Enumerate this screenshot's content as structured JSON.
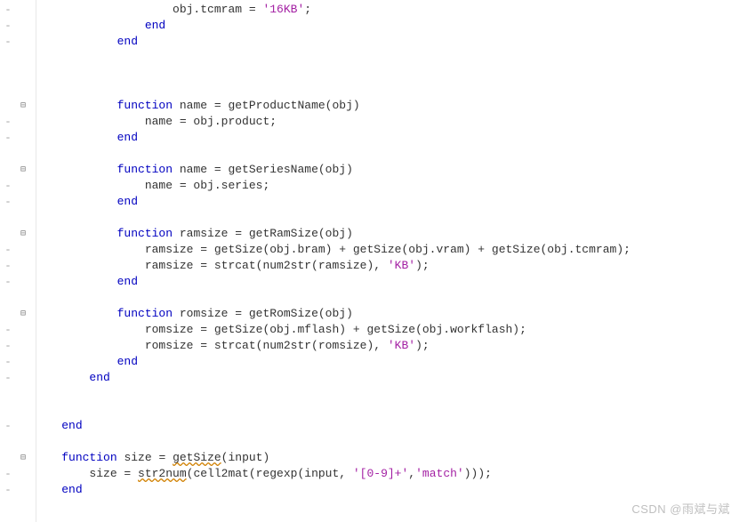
{
  "gutter": {
    "dash": "-",
    "blank": ""
  },
  "fold": {
    "minus": "⊟",
    "plus": "⊞",
    "blank": ""
  },
  "lines": [
    {
      "g": "dash",
      "f": "blank",
      "indent": 20,
      "tokens": [
        {
          "t": "id",
          "v": "obj.tcmram = "
        },
        {
          "t": "str",
          "v": "'16KB'"
        },
        {
          "t": "id",
          "v": ";"
        }
      ]
    },
    {
      "g": "dash",
      "f": "blank",
      "indent": 16,
      "tokens": [
        {
          "t": "kw",
          "v": "end"
        }
      ]
    },
    {
      "g": "dash",
      "f": "blank",
      "indent": 12,
      "tokens": [
        {
          "t": "kw",
          "v": "end"
        }
      ]
    },
    {
      "g": "blank",
      "f": "blank",
      "indent": 0,
      "tokens": []
    },
    {
      "g": "blank",
      "f": "blank",
      "indent": 0,
      "tokens": []
    },
    {
      "g": "blank",
      "f": "blank",
      "indent": 0,
      "tokens": []
    },
    {
      "g": "blank",
      "f": "minus",
      "indent": 12,
      "tokens": [
        {
          "t": "kw",
          "v": "function"
        },
        {
          "t": "id",
          "v": " name = getProductName(obj)"
        }
      ]
    },
    {
      "g": "dash",
      "f": "blank",
      "indent": 16,
      "tokens": [
        {
          "t": "id",
          "v": "name = obj.product;"
        }
      ]
    },
    {
      "g": "dash",
      "f": "blank",
      "indent": 12,
      "tokens": [
        {
          "t": "kw",
          "v": "end"
        }
      ]
    },
    {
      "g": "blank",
      "f": "blank",
      "indent": 0,
      "tokens": []
    },
    {
      "g": "blank",
      "f": "minus",
      "indent": 12,
      "tokens": [
        {
          "t": "kw",
          "v": "function"
        },
        {
          "t": "id",
          "v": " name = getSeriesName(obj)"
        }
      ]
    },
    {
      "g": "dash",
      "f": "blank",
      "indent": 16,
      "tokens": [
        {
          "t": "id",
          "v": "name = obj.series;"
        }
      ]
    },
    {
      "g": "dash",
      "f": "blank",
      "indent": 12,
      "tokens": [
        {
          "t": "kw",
          "v": "end"
        }
      ]
    },
    {
      "g": "blank",
      "f": "blank",
      "indent": 0,
      "tokens": []
    },
    {
      "g": "blank",
      "f": "minus",
      "indent": 12,
      "tokens": [
        {
          "t": "kw",
          "v": "function"
        },
        {
          "t": "id",
          "v": " ramsize = getRamSize(obj)"
        }
      ]
    },
    {
      "g": "dash",
      "f": "blank",
      "indent": 16,
      "tokens": [
        {
          "t": "id",
          "v": "ramsize = getSize(obj.bram) + getSize(obj.vram) + getSize(obj.tcmram);"
        }
      ]
    },
    {
      "g": "dash",
      "f": "blank",
      "indent": 16,
      "tokens": [
        {
          "t": "id",
          "v": "ramsize = strcat(num2str(ramsize), "
        },
        {
          "t": "str",
          "v": "'KB'"
        },
        {
          "t": "id",
          "v": ");"
        }
      ]
    },
    {
      "g": "dash",
      "f": "blank",
      "indent": 12,
      "tokens": [
        {
          "t": "kw",
          "v": "end"
        }
      ]
    },
    {
      "g": "blank",
      "f": "blank",
      "indent": 0,
      "tokens": []
    },
    {
      "g": "blank",
      "f": "minus",
      "indent": 12,
      "tokens": [
        {
          "t": "kw",
          "v": "function"
        },
        {
          "t": "id",
          "v": " romsize = getRomSize(obj)"
        }
      ]
    },
    {
      "g": "dash",
      "f": "blank",
      "indent": 16,
      "tokens": [
        {
          "t": "id",
          "v": "romsize = getSize(obj.mflash) + getSize(obj.workflash);"
        }
      ]
    },
    {
      "g": "dash",
      "f": "blank",
      "indent": 16,
      "tokens": [
        {
          "t": "id",
          "v": "romsize = strcat(num2str(romsize), "
        },
        {
          "t": "str",
          "v": "'KB'"
        },
        {
          "t": "id",
          "v": ");"
        }
      ]
    },
    {
      "g": "dash",
      "f": "blank",
      "indent": 12,
      "tokens": [
        {
          "t": "kw",
          "v": "end"
        }
      ]
    },
    {
      "g": "dash",
      "f": "blank",
      "indent": 8,
      "tokens": [
        {
          "t": "kw",
          "v": "end"
        }
      ]
    },
    {
      "g": "blank",
      "f": "blank",
      "indent": 0,
      "tokens": []
    },
    {
      "g": "blank",
      "f": "blank",
      "indent": 0,
      "tokens": []
    },
    {
      "g": "dash",
      "f": "blank",
      "indent": 4,
      "tokens": [
        {
          "t": "kw",
          "v": "end"
        }
      ]
    },
    {
      "g": "blank",
      "f": "blank",
      "indent": 0,
      "tokens": []
    },
    {
      "g": "blank",
      "f": "minus",
      "indent": 4,
      "tokens": [
        {
          "t": "kw",
          "v": "function"
        },
        {
          "t": "id",
          "v": " size = "
        },
        {
          "t": "id",
          "v": "getSize",
          "u": true
        },
        {
          "t": "id",
          "v": "(input)"
        }
      ]
    },
    {
      "g": "dash",
      "f": "blank",
      "indent": 8,
      "tokens": [
        {
          "t": "id",
          "v": "size = "
        },
        {
          "t": "id",
          "v": "str2num",
          "u": true
        },
        {
          "t": "id",
          "v": "(cell2mat(regexp(input, "
        },
        {
          "t": "str",
          "v": "'[0-9]+'"
        },
        {
          "t": "id",
          "v": ","
        },
        {
          "t": "str",
          "v": "'match'"
        },
        {
          "t": "id",
          "v": ")));"
        }
      ]
    },
    {
      "g": "dash",
      "f": "blank",
      "indent": 4,
      "tokens": [
        {
          "t": "kw",
          "v": "end"
        }
      ]
    }
  ],
  "watermark": "CSDN @雨斌与斌"
}
